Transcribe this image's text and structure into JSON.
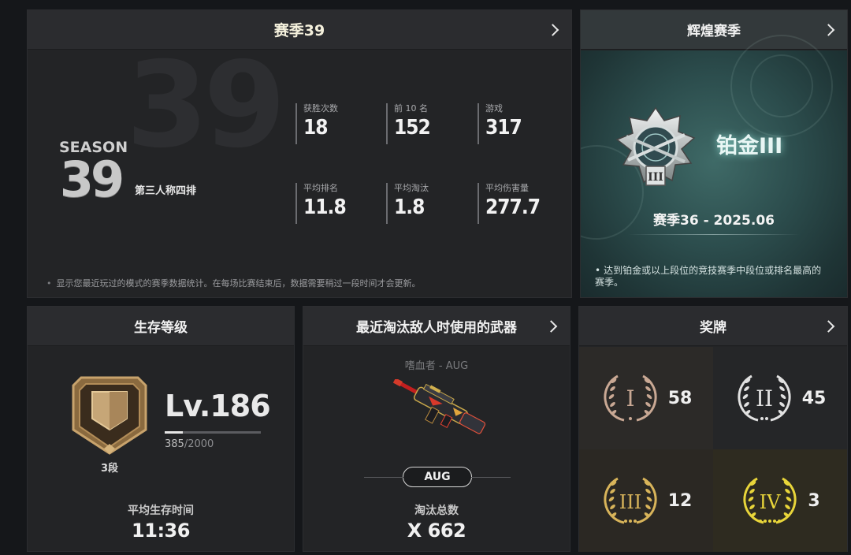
{
  "season": {
    "title": "赛季39",
    "bg_number": "39",
    "logo_word": "SEASON",
    "logo_number": "39",
    "mode": "第三人称四排",
    "stats": [
      {
        "label": "获胜次数",
        "value": "18"
      },
      {
        "label": "前 10 名",
        "value": "152"
      },
      {
        "label": "游戏",
        "value": "317"
      },
      {
        "label": "平均排名",
        "value": "11.8"
      },
      {
        "label": "平均淘汰",
        "value": "1.8"
      },
      {
        "label": "平均伤害量",
        "value": "277.7"
      }
    ],
    "note": "显示您最近玩过的模式的赛季数据统计。在每场比赛结束后，数据需要稍过一段时间才会更新。"
  },
  "glory": {
    "title": "辉煌赛季",
    "rank_name": "铂金III",
    "badge_numeral": "III",
    "season_text": "赛季36 - 2025.06",
    "description": "达到铂金或以上段位的竞技赛季中段位或排名最高的赛季。"
  },
  "survival": {
    "title": "生存等级",
    "level": "Lv.186",
    "xp_current": "385",
    "xp_max": "/2000",
    "xp_fraction": 0.1925,
    "tier": "3段",
    "avg_time_label": "平均生存时间",
    "avg_time_value": "11:36"
  },
  "weapon": {
    "title": "最近淘汰敌人时使用的武器",
    "skin_name": "嗜血者 - AUG",
    "tag": "AUG",
    "kills_label": "淘汰总数",
    "kills_value": "X 662"
  },
  "medals": {
    "title": "奖牌",
    "items": [
      {
        "numeral": "I",
        "count": "58",
        "color": "#c9a894"
      },
      {
        "numeral": "II",
        "count": "45",
        "color": "#e1e1e1"
      },
      {
        "numeral": "III",
        "count": "12",
        "color": "#d8b45a"
      },
      {
        "numeral": "IV",
        "count": "3",
        "color": "#e8d53a"
      }
    ]
  }
}
